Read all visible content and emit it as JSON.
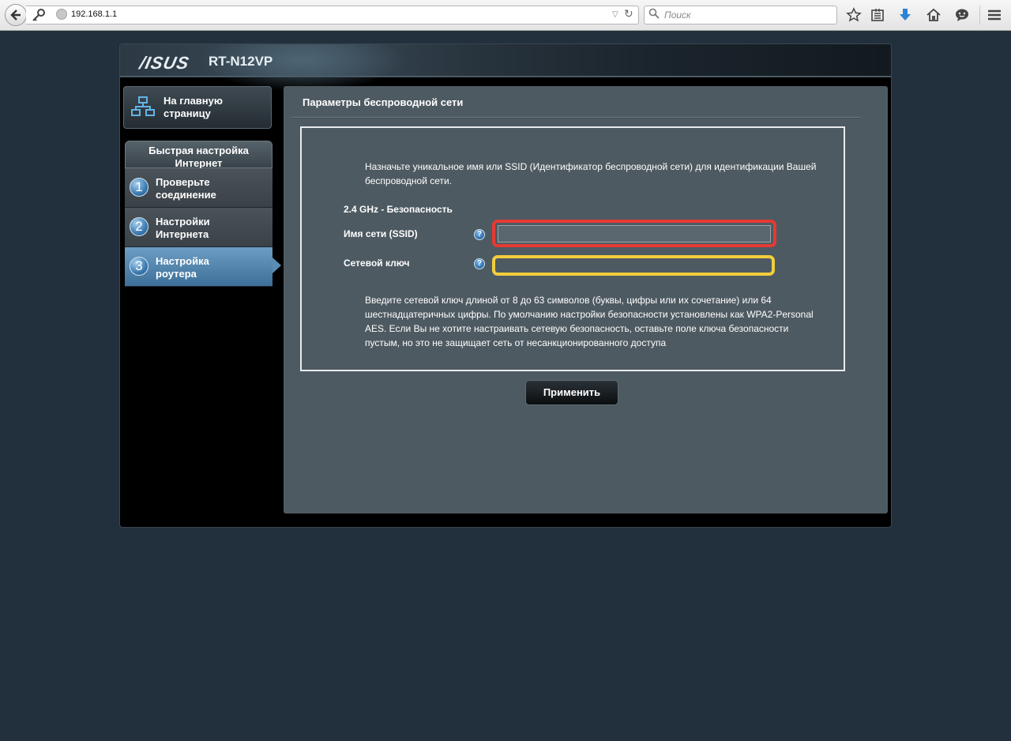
{
  "browser": {
    "url": "192.168.1.1",
    "search_placeholder": "Поиск"
  },
  "router": {
    "brand": "/ISUS",
    "model": "RT-N12VP"
  },
  "menu": {
    "home_label": "На главную страницу",
    "qis_header": "Быстрая настройка Интернет",
    "steps": [
      {
        "number": "1",
        "label": "Проверьте соединение"
      },
      {
        "number": "2",
        "label": "Настройки Интернета"
      },
      {
        "number": "3",
        "label": "Настройка роутера",
        "active": true
      }
    ]
  },
  "content": {
    "title": "Параметры беспроводной сети",
    "intro": "Назначьте уникальное имя или SSID (Идентификатор беспроводной сети) для идентификации Вашей беспроводной сети.",
    "band": "2.4 GHz - Безопасность",
    "ssid_label": "Имя сети (SSID)",
    "ssid_value": "",
    "key_label": "Сетевой ключ",
    "key_value": "",
    "help_glyph": "?",
    "note": "Введите сетевой ключ длиной от 8 до 63 символов (буквы, цифры или их сочетание) или 64 шестнадцатеричных цифры. По умолчанию настройки безопасности установлены как WPA2-Personal AES. Если Вы не хотите настраивать сетевую безопасность, оставьте поле ключа безопасности пустым, но это не защищает сеть от несанкционированного доступа",
    "apply_label": "Применить"
  },
  "highlights": {
    "ssid_outline": "#e53a33",
    "key_outline": "#f2cd3c"
  }
}
